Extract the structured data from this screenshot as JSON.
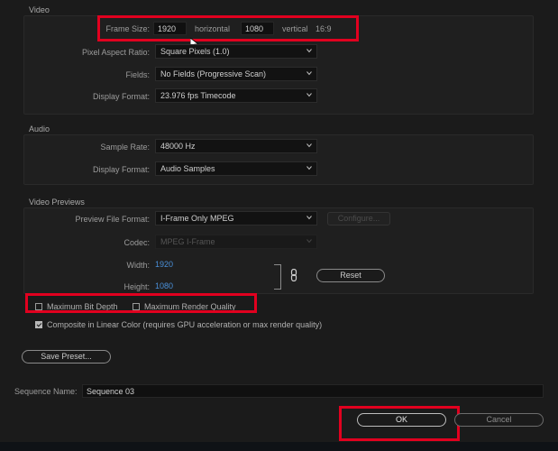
{
  "video": {
    "section_title": "Video",
    "frame_size_label": "Frame Size:",
    "frame_width": "1920",
    "horizontal_label": "horizontal",
    "frame_height": "1080",
    "vertical_label": "vertical",
    "aspect": "16:9",
    "pixel_aspect_label": "Pixel Aspect Ratio:",
    "pixel_aspect_value": "Square Pixels (1.0)",
    "fields_label": "Fields:",
    "fields_value": "No Fields (Progressive Scan)",
    "display_format_label": "Display Format:",
    "display_format_value": "23.976 fps Timecode"
  },
  "audio": {
    "section_title": "Audio",
    "sample_rate_label": "Sample Rate:",
    "sample_rate_value": "48000 Hz",
    "display_format_label": "Display Format:",
    "display_format_value": "Audio Samples"
  },
  "previews": {
    "section_title": "Video Previews",
    "preview_format_label": "Preview File Format:",
    "preview_format_value": "I-Frame Only MPEG",
    "configure_label": "Configure...",
    "codec_label": "Codec:",
    "codec_value": "MPEG I-Frame",
    "width_label": "Width:",
    "width_value": "1920",
    "height_label": "Height:",
    "height_value": "1080",
    "reset_label": "Reset"
  },
  "options": {
    "max_bit_depth": "Maximum Bit Depth",
    "max_render_quality": "Maximum Render Quality",
    "composite_linear": "Composite in Linear Color (requires GPU acceleration or max render quality)"
  },
  "save_preset_label": "Save Preset...",
  "sequence_name_label": "Sequence Name:",
  "sequence_name_value": "Sequence 03",
  "ok_label": "OK",
  "cancel_label": "Cancel",
  "colors": {
    "highlight": "#e1001f",
    "link_blue": "#4a90d9"
  }
}
